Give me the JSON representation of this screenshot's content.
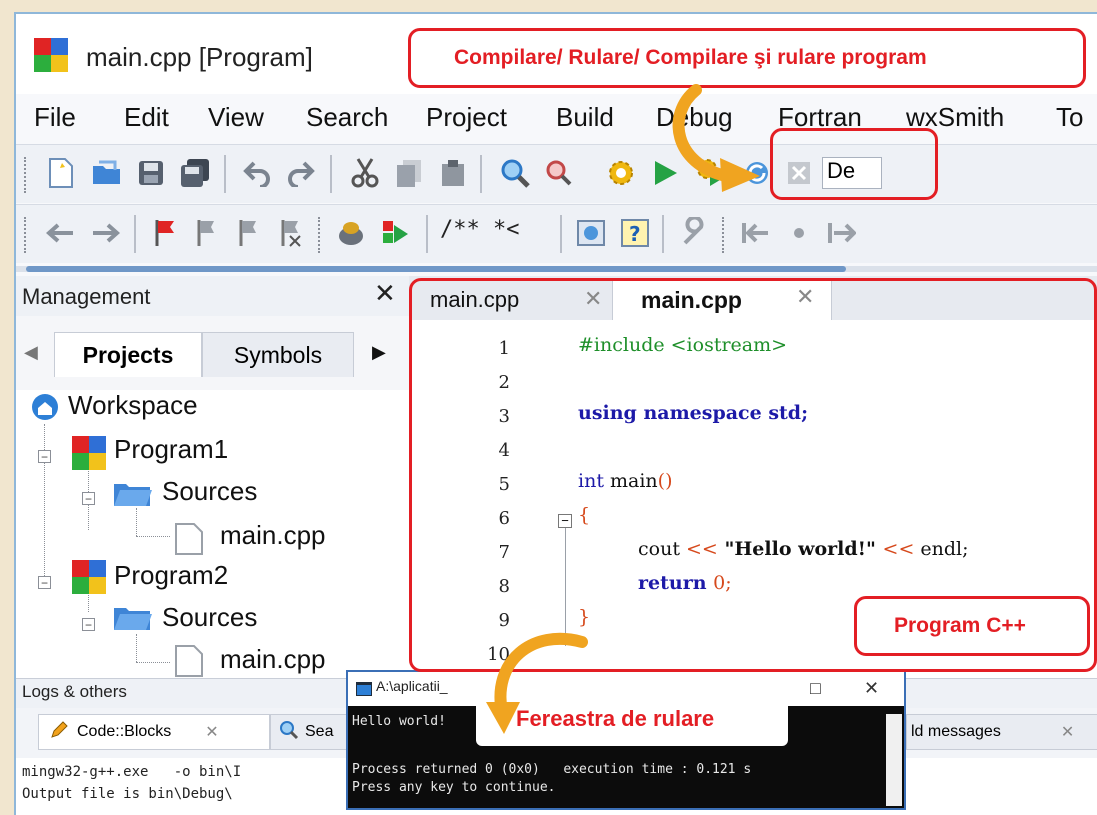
{
  "window": {
    "title": "main.cpp [Program]"
  },
  "menu": [
    "File",
    "Edit",
    "View",
    "Search",
    "Project",
    "Build",
    "Debug",
    "Fortran",
    "wxSmith",
    "To"
  ],
  "toolbar": {
    "build_target": "De"
  },
  "management": {
    "title": "Management",
    "close": "✕",
    "tabs": [
      "Projects",
      "Symbols"
    ],
    "tree": {
      "workspace": "Workspace",
      "program1": "Program1",
      "sources1": "Sources",
      "file1": "main.cpp",
      "program2": "Program2",
      "sources2": "Sources",
      "file2": "main.cpp"
    }
  },
  "editor": {
    "tabs": [
      {
        "label": "main.cpp",
        "close": "✕"
      },
      {
        "label": "main.cpp",
        "close": "✕"
      }
    ],
    "line_numbers": [
      "1",
      "2",
      "3",
      "4",
      "5",
      "6",
      "7",
      "8",
      "9",
      "10"
    ],
    "code": {
      "l1": "#include <iostream>",
      "l3a": "using namespace ",
      "l3b": "std;",
      "l5a": "int ",
      "l5b": "main",
      "l5c": "()",
      "l6": "{",
      "l7a": "cout ",
      "l7b": "<<",
      "l7c": " \"Hello world!\" ",
      "l7d": "<<",
      "l7e": " endl;",
      "l8a": "return ",
      "l8b": "0;",
      "l9": "}"
    }
  },
  "logs": {
    "title": "Logs & others",
    "tabs": [
      "Code::Blocks",
      "Sea",
      "ld messages"
    ],
    "lines": [
      "mingw32-g++.exe   -o bin\\I",
      "Output file is bin\\Debug\\"
    ]
  },
  "console": {
    "title": "A:\\aplicatii_",
    "minimize": "□",
    "close": "✕",
    "lines": [
      "Hello world!",
      "",
      "Process returned 0 (0x0)   execution time : 0.121 s",
      "Press any key to continue."
    ]
  },
  "annotations": {
    "compile_run": "Compilare/ Rulare/ Compilare şi rulare program",
    "program": "Program C++",
    "run_window": "Fereastra de rulare"
  },
  "colors": {
    "callout": "#e31e24",
    "arrow": "#f0a420",
    "keyword": "#1d1aa8",
    "preproc": "#1e8f2a",
    "string": "#1a1a1a",
    "number": "#d6491c"
  }
}
